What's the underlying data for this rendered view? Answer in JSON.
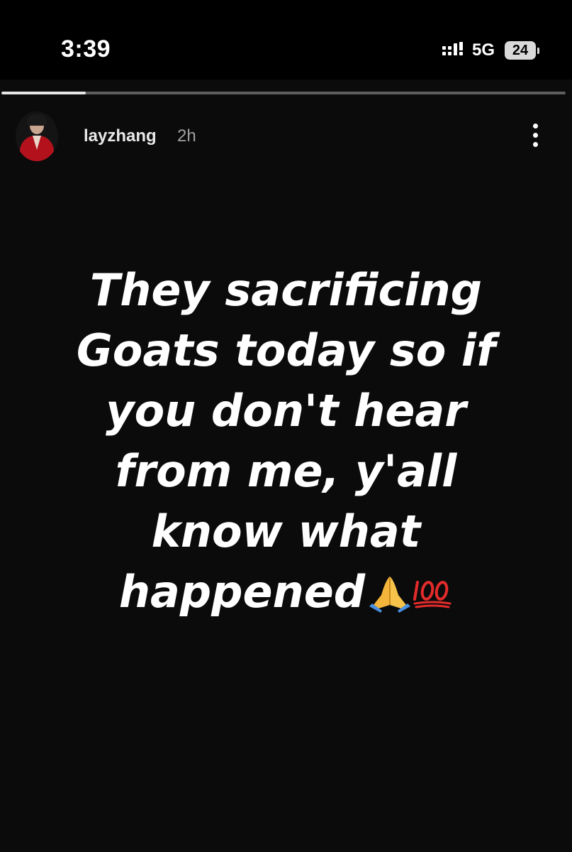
{
  "status_bar": {
    "time": "3:39",
    "network": "5G",
    "battery_level": "24",
    "signal_icon": "signal-bars-icon"
  },
  "story": {
    "progress": 0.15,
    "username": "layzhang",
    "age": "2h",
    "avatar_icon": "profile-avatar",
    "more_icon": "more-vertical-icon",
    "text_lines": [
      "They sacrificing",
      "Goats today so if",
      "you don't hear",
      "from me, y'all",
      "know what",
      "happened"
    ],
    "emojis": [
      "folded-hands-icon",
      "hundred-points-icon"
    ]
  },
  "colors": {
    "background": "#0b0b0b",
    "status_bar": "#000000",
    "text": "#ffffff",
    "progress_track": "#5e5e5e",
    "progress_fill": "#e6e6e6",
    "avatar_accent": "#b3121d"
  }
}
